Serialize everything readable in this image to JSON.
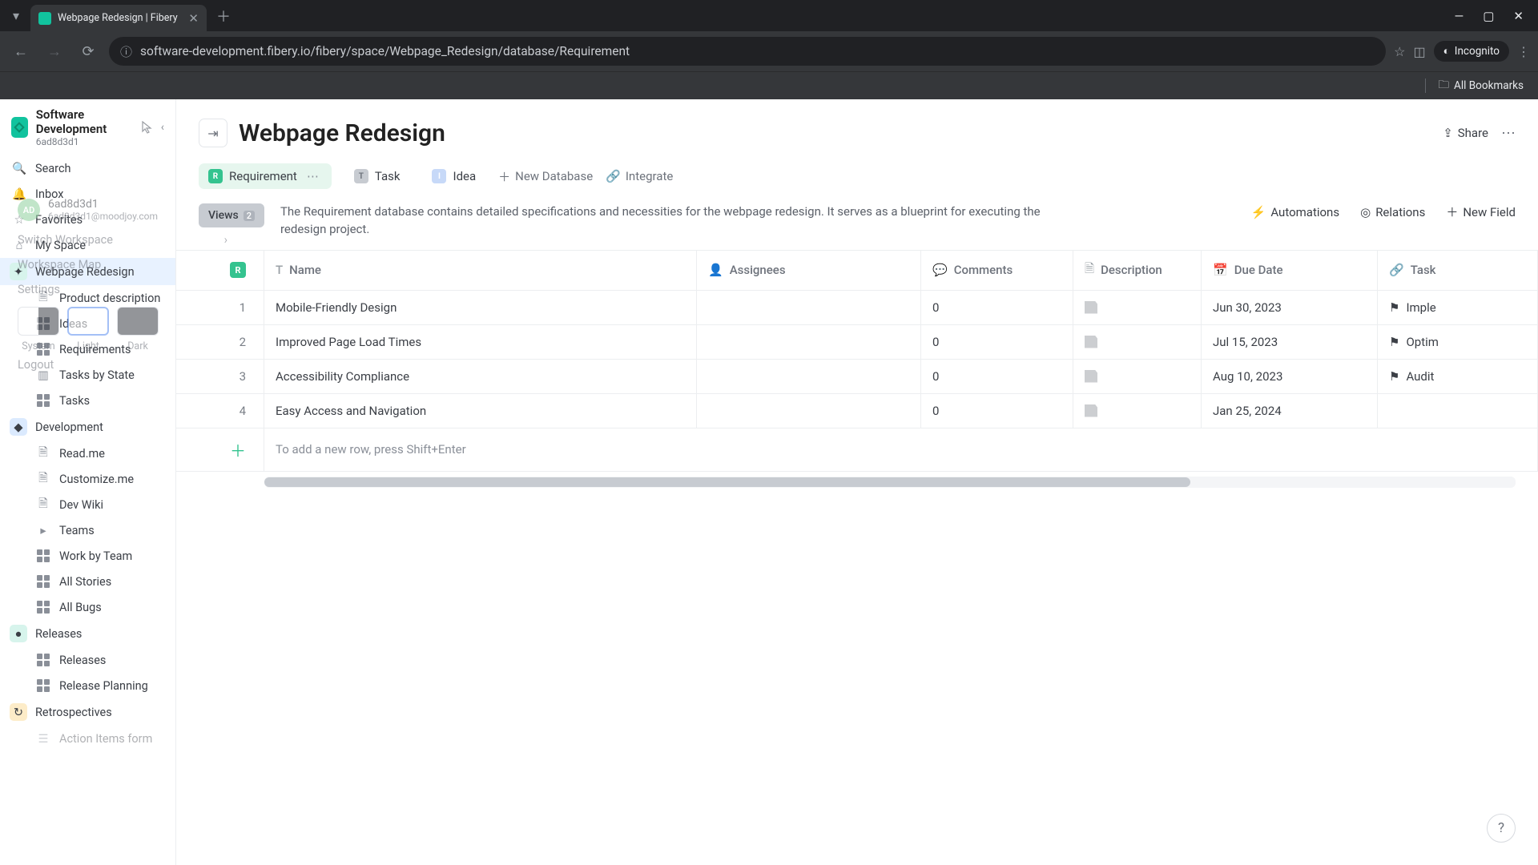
{
  "browser": {
    "tab_title": "Webpage Redesign | Fibery",
    "url": "software-development.fibery.io/fibery/space/Webpage_Redesign/database/Requirement",
    "incognito_label": "Incognito",
    "all_bookmarks": "All Bookmarks"
  },
  "workspace": {
    "name": "Software Development",
    "id": "6ad8d3d1"
  },
  "sidebar": {
    "search": "Search",
    "inbox": "Inbox",
    "favorites": "Favorites",
    "my_space": "My Space",
    "spaces": {
      "webpage_redesign": "Webpage Redesign",
      "wr_children": [
        "Product description",
        "Ideas",
        "Requirements",
        "Tasks by State",
        "Tasks"
      ],
      "development": "Development",
      "dev_children": [
        "Read.me",
        "Customize.me",
        "Dev Wiki",
        "Teams",
        "Work by Team",
        "All Stories",
        "All Bugs"
      ],
      "releases": "Releases",
      "rel_children": [
        "Releases",
        "Release Planning"
      ],
      "retrospectives": "Retrospectives",
      "retro_children": [
        "Action Items form"
      ]
    }
  },
  "popup": {
    "user_id": "6ad8d3d1",
    "user_email": "6ad8d3d1@moodjoy.com",
    "avatar_initials": "AD",
    "switch_workspace": "Switch Workspace",
    "workspace_map": "Workspace Map",
    "settings": "Settings",
    "themes": {
      "system": "System",
      "light": "Light",
      "dark": "Dark"
    },
    "logout": "Logout"
  },
  "page": {
    "title": "Webpage Redesign",
    "share": "Share"
  },
  "db_tabs": {
    "requirement": "Requirement",
    "task": "Task",
    "idea": "Idea",
    "new_db": "New Database",
    "integrate": "Integrate"
  },
  "views": {
    "label": "Views",
    "count": "2"
  },
  "description": "The Requirement database contains detailed specifications and necessities for the webpage redesign. It serves as a blueprint for executing the redesign project.",
  "toolbar": {
    "automations": "Automations",
    "relations": "Relations",
    "new_field": "New Field"
  },
  "columns": {
    "name": "Name",
    "assignees": "Assignees",
    "comments": "Comments",
    "description": "Description",
    "due_date": "Due Date",
    "task": "Task"
  },
  "rows": [
    {
      "n": "1",
      "name": "Mobile-Friendly Design",
      "assignees": "",
      "comments": "0",
      "due": "Jun 30, 2023",
      "task": "Imple"
    },
    {
      "n": "2",
      "name": "Improved Page Load Times",
      "assignees": "",
      "comments": "0",
      "due": "Jul 15, 2023",
      "task": "Optim"
    },
    {
      "n": "3",
      "name": "Accessibility Compliance",
      "assignees": "",
      "comments": "0",
      "due": "Aug 10, 2023",
      "task": "Audit"
    },
    {
      "n": "4",
      "name": "Easy Access and Navigation",
      "assignees": "",
      "comments": "0",
      "due": "Jan 25, 2024",
      "task": ""
    }
  ],
  "add_row_hint": "To add a new row, press Shift+Enter",
  "help": "?"
}
